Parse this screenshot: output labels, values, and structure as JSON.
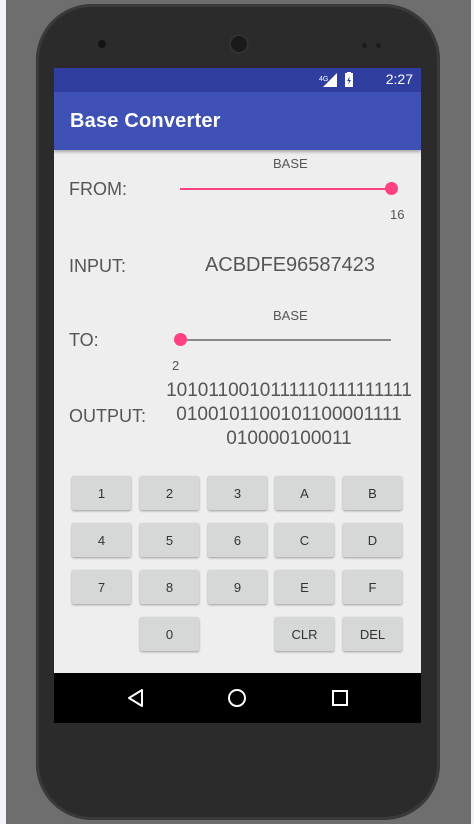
{
  "status": {
    "network": "4G",
    "time": "2:27"
  },
  "app": {
    "title": "Base Converter"
  },
  "from": {
    "label": "FROM:",
    "base_caption": "BASE",
    "value": "16",
    "slider_fraction": 1.0
  },
  "input": {
    "label": "INPUT:",
    "value": "ACBDFE96587423"
  },
  "to": {
    "label": "TO:",
    "base_caption": "BASE",
    "value": "2",
    "slider_fraction": 0.0
  },
  "output": {
    "label": "OUTPUT:",
    "lines": [
      "1010110010111110111111111",
      "0100101100101100001111",
      "010000100011"
    ]
  },
  "keypad": {
    "k1": "1",
    "k2": "2",
    "k3": "3",
    "kA": "A",
    "kB": "B",
    "k4": "4",
    "k5": "5",
    "k6": "6",
    "kC": "C",
    "kD": "D",
    "k7": "7",
    "k8": "8",
    "k9": "9",
    "kE": "E",
    "kF": "F",
    "k0": "0",
    "clr": "CLR",
    "del": "DEL"
  },
  "icons": {
    "signal": "signal-icon",
    "battery": "battery-icon",
    "back": "back-icon",
    "home": "home-icon",
    "recents": "recents-icon"
  },
  "colors": {
    "primary": "#3f51b5",
    "primary_dark": "#303f9f",
    "accent": "#ff4081"
  }
}
